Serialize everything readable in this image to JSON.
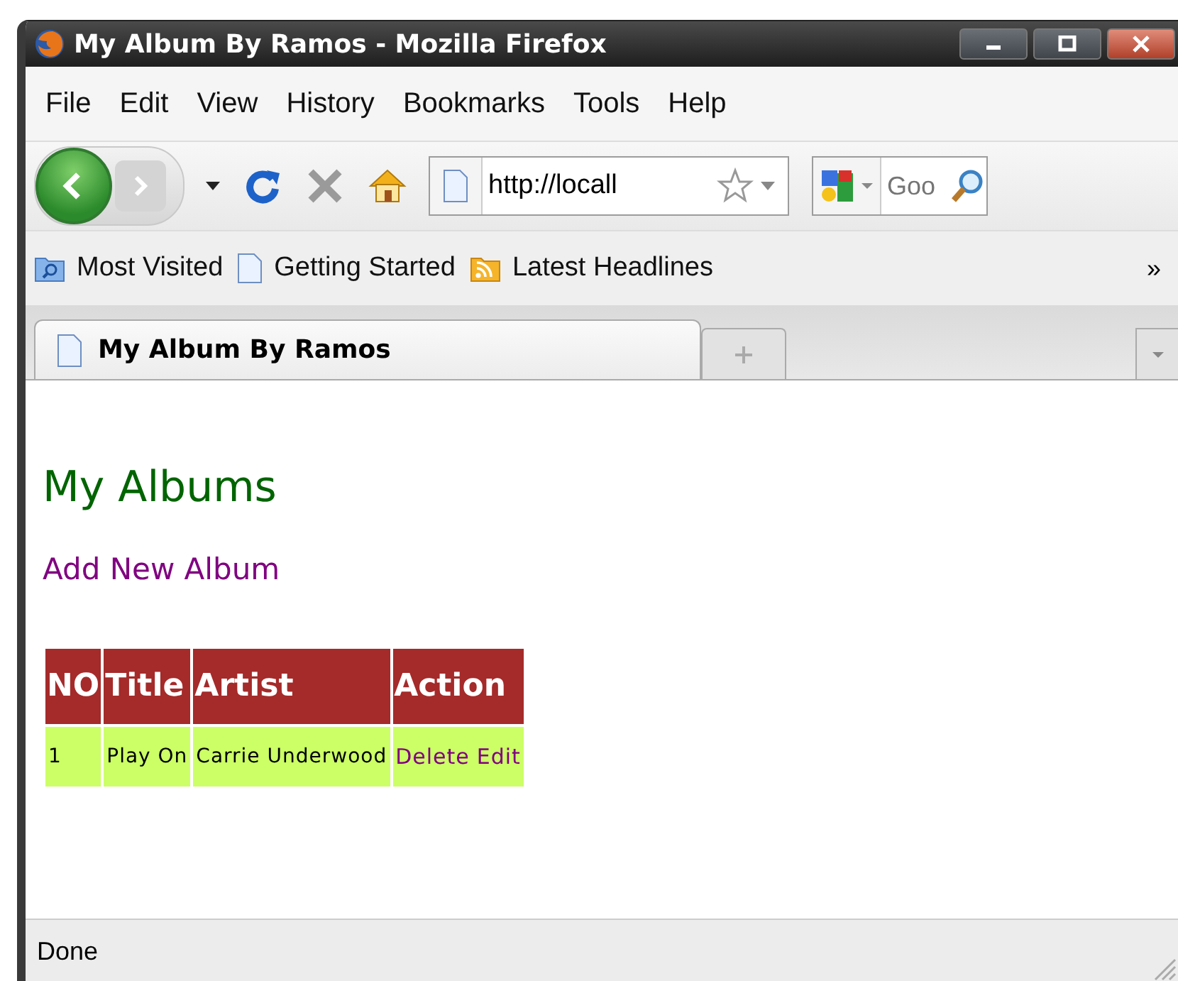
{
  "window": {
    "title": "My Album By Ramos - Mozilla Firefox"
  },
  "menu": [
    "File",
    "Edit",
    "View",
    "History",
    "Bookmarks",
    "Tools",
    "Help"
  ],
  "toolbar": {
    "url": "http://locall",
    "search_placeholder": "Goo"
  },
  "bookmarks": [
    {
      "label": "Most Visited",
      "kind": "folder"
    },
    {
      "label": "Getting Started",
      "kind": "page"
    },
    {
      "label": "Latest Headlines",
      "kind": "feed"
    }
  ],
  "bookmarks_overflow": "»",
  "tabs": [
    {
      "label": "My Album By Ramos",
      "selected": true
    }
  ],
  "page": {
    "heading": "My Albums",
    "add_link": "Add New Album",
    "table": {
      "columns": [
        "NO",
        "Title",
        "Artist",
        "Action"
      ],
      "rows": [
        {
          "no": "1",
          "title": "Play On",
          "artist": "Carrie Underwood",
          "actions": [
            "Delete",
            "Edit"
          ]
        }
      ]
    }
  },
  "status_bar": "Done"
}
